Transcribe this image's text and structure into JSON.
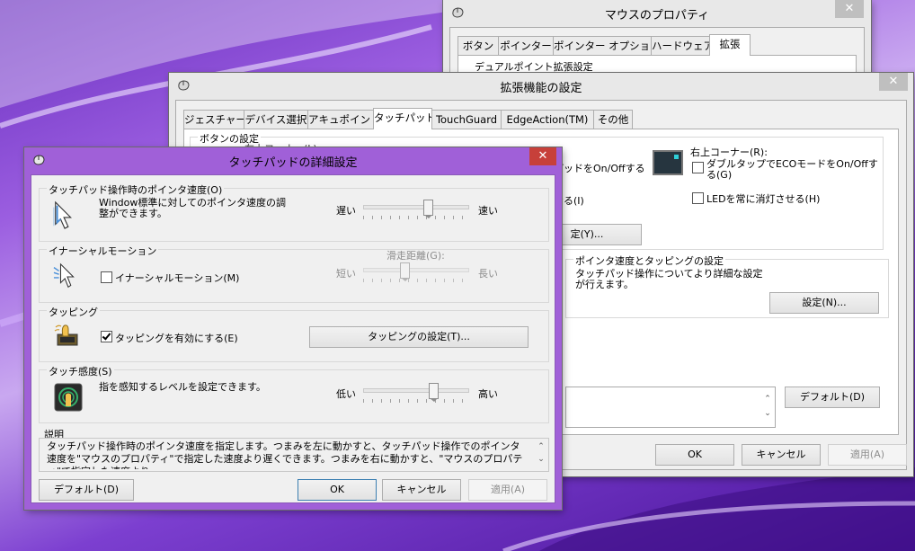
{
  "colors": {
    "accent_close": "#c7403a",
    "touch_frame": "#a060d8",
    "main_frame": "#e8e8e8"
  },
  "mouse_props": {
    "title": "マウスのプロパティ",
    "close": "✕",
    "tabs": [
      "ボタン",
      "ポインター",
      "ポインター オプション",
      "ハードウェア",
      "拡張"
    ],
    "partial_label": "デュアルポイント拡張設定"
  },
  "ext": {
    "title": "拡張機能の設定",
    "close": "✕",
    "tabs": [
      "ジェスチャー",
      "デバイス選択",
      "アキュポイント",
      "タッチパッド",
      "TouchGuard",
      "EdgeAction(TM)",
      "その他"
    ],
    "button_group_label": "ボタンの設定",
    "partial_top": "左上コーナー(L)",
    "partial_a": "パッドをOn/Offする",
    "partial_b": "せる(I)",
    "partial_btn": "定(Y)...",
    "corner_right_label": "右上コーナー(R):",
    "corner_right_chk1": "ダブルタップでECOモードをOn/Offする(G)",
    "corner_right_chk2": "LEDを常に消灯させる(H)",
    "pointer_group_label": "ポインタ速度とタッピングの設定",
    "pointer_text": "タッチパッド操作についてより詳細な設定が行えます。",
    "settings_btn": "設定(N)...",
    "default_btn": "デフォルト(D)",
    "ok": "OK",
    "cancel": "キャンセル",
    "apply": "適用(A)"
  },
  "touch": {
    "title": "タッチパッドの詳細設定",
    "close": "✕",
    "speed": {
      "label": "タッチパッド操作時のポインタ速度(O)",
      "text": "Window標準に対してのポインタ速度の調整ができます。",
      "slow": "遅い",
      "fast": "速い",
      "level": 0.62
    },
    "inertia": {
      "label": "イナーシャルモーション",
      "checkbox": "イナーシャルモーション(M)",
      "checked": false,
      "slider_label": "滑走距離(G):",
      "short": "短い",
      "long": "長い",
      "level": 0.38
    },
    "tapping": {
      "label": "タッピング",
      "checkbox": "タッピングを有効にする(E)",
      "checked": true,
      "button": "タッピングの設定(T)..."
    },
    "sensitivity": {
      "label": "タッチ感度(S)",
      "text": "指を感知するレベルを設定できます。",
      "low": "低い",
      "high": "高い",
      "level": 0.68
    },
    "desc": {
      "label": "説明",
      "text": "タッチパッド操作時のポインタ速度を指定します。つまみを左に動かすと、タッチパッド操作でのポインタ速度を\"マウスのプロパティ\"で指定した速度より遅くできます。つまみを右に動かすと、\"マウスのプロパティ\"で指定した速度より"
    },
    "default_btn": "デフォルト(D)",
    "ok": "OK",
    "cancel": "キャンセル",
    "apply": "適用(A)"
  }
}
